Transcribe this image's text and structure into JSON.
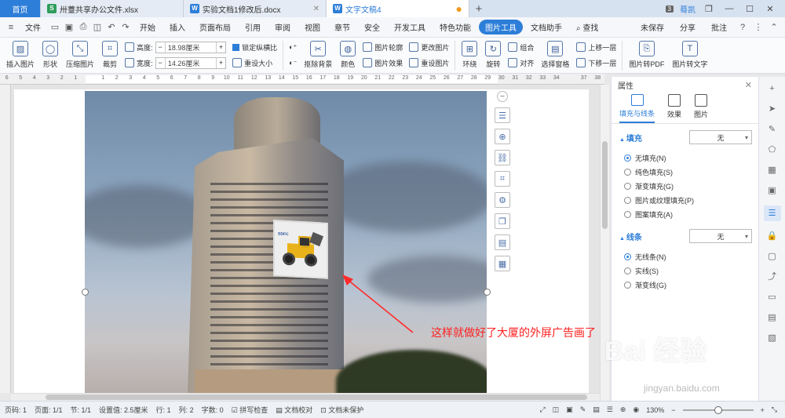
{
  "tabs": [
    {
      "label": "首页",
      "type": "home"
    },
    {
      "label": "卅薹共享办公文件.xlsx",
      "type": "doc",
      "icon": "S",
      "color": "#2e9e5b"
    },
    {
      "label": "实验文档1修改后.docx",
      "type": "doc",
      "icon": "W",
      "color": "#2d7ed8"
    },
    {
      "label": "文字文稿4",
      "type": "active",
      "icon": "W",
      "color": "#2d7ed8"
    }
  ],
  "window": {
    "badge": "3",
    "user": "蓦凯"
  },
  "menu": {
    "file": "文件",
    "items": [
      "开始",
      "插入",
      "页面布局",
      "引用",
      "审阅",
      "视图",
      "章节",
      "安全",
      "开发工具",
      "特色功能",
      "图片工具",
      "文档助手"
    ],
    "active": "图片工具",
    "search": "查找",
    "unsaved": "未保存",
    "share": "分享",
    "annotate": "批注"
  },
  "ribbon": {
    "insert_pic": "插入图片",
    "shape": "形状",
    "compress": "压缩图片",
    "crop": "裁剪",
    "height_label": "高度:",
    "height_value": "18.98厘米",
    "width_label": "宽度:",
    "width_value": "14.26厘米",
    "lock_ratio": "锁定纵横比",
    "reset_size": "重设大小",
    "remove_bg": "抠除背景",
    "color": "颜色",
    "pic_outline": "图片轮廓",
    "pic_effect": "图片效果",
    "change_pic": "更改图片",
    "reset_pic": "重设图片",
    "wrap": "环绕",
    "rotate": "旋转",
    "group": "组合",
    "align": "对齐",
    "select_pane": "选择窗格",
    "bring_forward": "上移一层",
    "send_backward": "下移一层",
    "to_pdf": "图片转PDF",
    "to_text": "图片转文字"
  },
  "ruler_marks": [
    "6",
    "5",
    "4",
    "3",
    "2",
    "1",
    "",
    "1",
    "2",
    "3",
    "4",
    "5",
    "6",
    "7",
    "8",
    "9",
    "10",
    "11",
    "12",
    "13",
    "14",
    "15",
    "16",
    "17",
    "18",
    "19",
    "20",
    "21",
    "22",
    "23",
    "24",
    "25",
    "26",
    "27",
    "28",
    "29",
    "30",
    "31",
    "32",
    "33",
    "34",
    "",
    "37",
    "38"
  ],
  "annotation": "这样就做好了大厦的外屏广告画了",
  "ad_logo": "SDFC",
  "panel": {
    "title": "属性",
    "tabs": [
      "填充与线条",
      "效果",
      "图片"
    ],
    "fill_title": "填充",
    "fill_value": "无",
    "fill_options": [
      "无填充(N)",
      "纯色填充(S)",
      "渐变填充(G)",
      "图片或纹理填充(P)",
      "图案填充(A)"
    ],
    "fill_selected": 0,
    "line_title": "线条",
    "line_value": "无",
    "line_options": [
      "无线条(N)",
      "实线(S)",
      "渐变线(G)"
    ],
    "line_selected": 0
  },
  "status": {
    "page": "页码: 1",
    "pages": "页面: 1/1",
    "section": "节: 1/1",
    "setting": "设置值: 2.5厘米",
    "row": "行: 1",
    "col": "列: 2",
    "words": "字数: 0",
    "spell": "拼写检查",
    "proof": "文档校对",
    "unprotected": "文档未保护",
    "zoom": "130%"
  },
  "watermark": {
    "main": "Bai 经验",
    "sub": "jingyan.baidu.com"
  }
}
